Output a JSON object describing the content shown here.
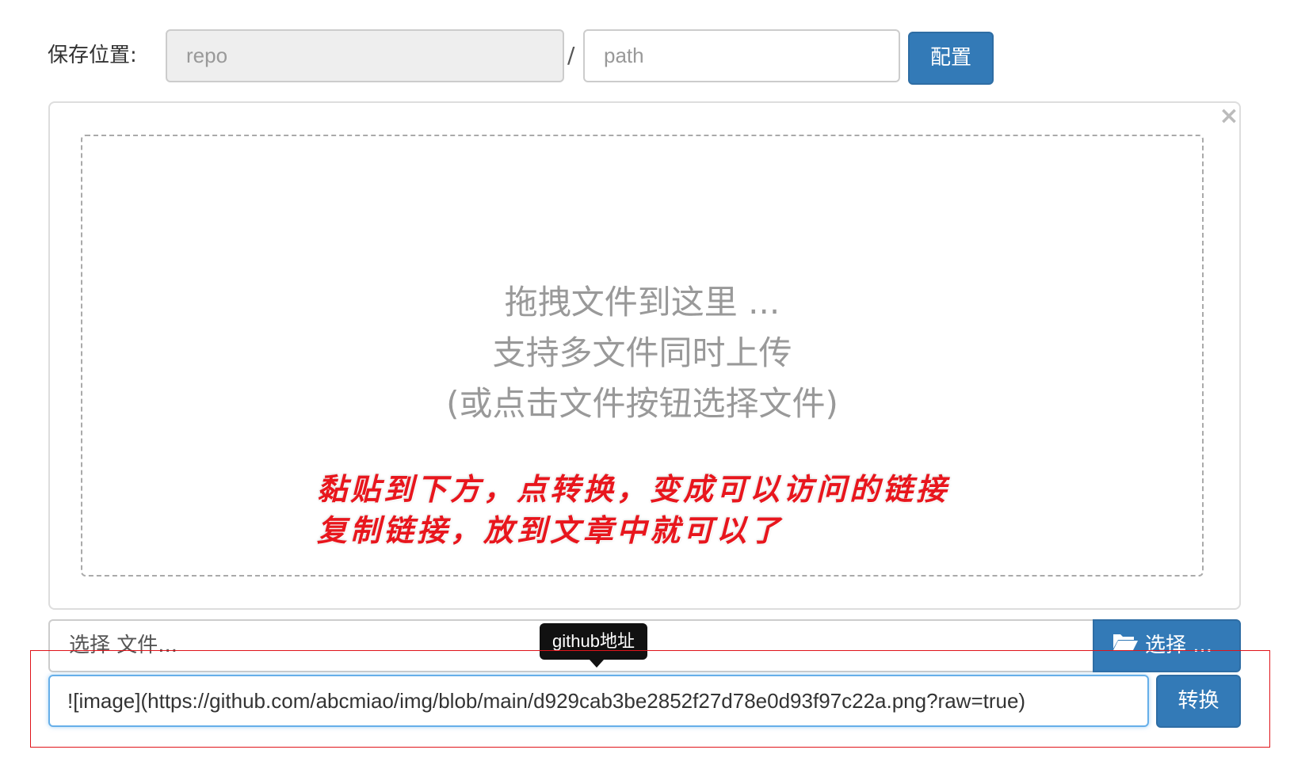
{
  "top": {
    "save_label": "保存位置:",
    "repo_placeholder": "repo",
    "separator": "/",
    "path_placeholder": "path",
    "config_button": "配置"
  },
  "dropzone": {
    "close_symbol": "×",
    "line1": "拖拽文件到这里 ...",
    "line2": "支持多文件同时上传",
    "line3": "(或点击文件按钮选择文件)"
  },
  "annotation": {
    "line1": "黏贴到下方，点转换，变成可以访问的链接",
    "line2": "复制链接，放到文章中就可以了",
    "color": "#e8161d"
  },
  "file_picker": {
    "placeholder": "选择 文件...",
    "button_label": "选择 ...",
    "button_icon": "folder-open-icon"
  },
  "tooltip": {
    "text": "github地址"
  },
  "link": {
    "value": "![image](https://github.com/abcmiao/img/blob/main/d929cab3be2852f27d78e0d93f97c22a.png?raw=true)",
    "convert_button": "转换"
  },
  "colors": {
    "primary": "#337ab7",
    "highlight_frame": "#e0141a"
  }
}
